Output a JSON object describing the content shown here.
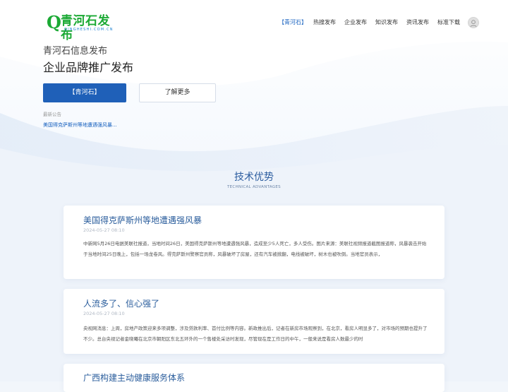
{
  "brand": {
    "name": "青河石发布",
    "initial": "Q",
    "domain": "QINGHESHI.COM.CN",
    "color": "#1ba934"
  },
  "nav": {
    "items": [
      {
        "label": "【青河石】",
        "active": true
      },
      {
        "label": "热搜发布",
        "active": false
      },
      {
        "label": "企业发布",
        "active": false
      },
      {
        "label": "知识发布",
        "active": false
      },
      {
        "label": "资讯发布",
        "active": false
      },
      {
        "label": "标准下载",
        "active": false
      }
    ]
  },
  "user": {
    "icon": "user-avatar-icon"
  },
  "hero": {
    "subtitle": "青河石信息发布",
    "title": "企业品牌推广发布",
    "primary_button": "【青河石】",
    "secondary_button": "了解更多",
    "notice_label": "最新公告",
    "notice_link": "美国得克萨斯州等地遭遇强风暴..."
  },
  "section": {
    "title": "技术优势",
    "subtitle": "TECHNICAL ADVANTAGES"
  },
  "articles": [
    {
      "title": "美国得克萨斯州等地遭遇强风暴",
      "date": "2024-05-27 08:10",
      "body": "中新网5月26日电据美联社报道，当地时间26日，美国得克萨斯州等地遭遇强风暴，造成至少5人死亡，多人受伤。图片来源：美联社视频报道截图报道称，风暴袭击开始于当地时间25日晚上，包括一场龙卷风。得克萨斯州警察官员称，风暴破坏了房屋，还有汽车被掀翻，电线被破坏，树木也被吹倒。当地官员表示，"
    },
    {
      "title": "人流多了、信心强了",
      "date": "2024-05-27 08:10",
      "body": "央视网消息：上周，房地产政策迎来多项调整，涉及贷款利率、首付比例等内容。新政推出后，记者在新房市场观察到，在北京，看房人明显多了，对市场的预期也提升了不少。总台央视记者金晓曦在北京市朝阳区东北五环外的一个售楼处采访时发现，尽管现在是工作日的中午，一般来说是看房人数最少的时"
    },
    {
      "title": "广西构建主动健康服务体系",
      "date": "",
      "body": ""
    }
  ],
  "colors": {
    "accent": "#1f60b8",
    "link": "#1a63c0",
    "heading": "#2a5d9c",
    "background": "#f2f6fb"
  }
}
